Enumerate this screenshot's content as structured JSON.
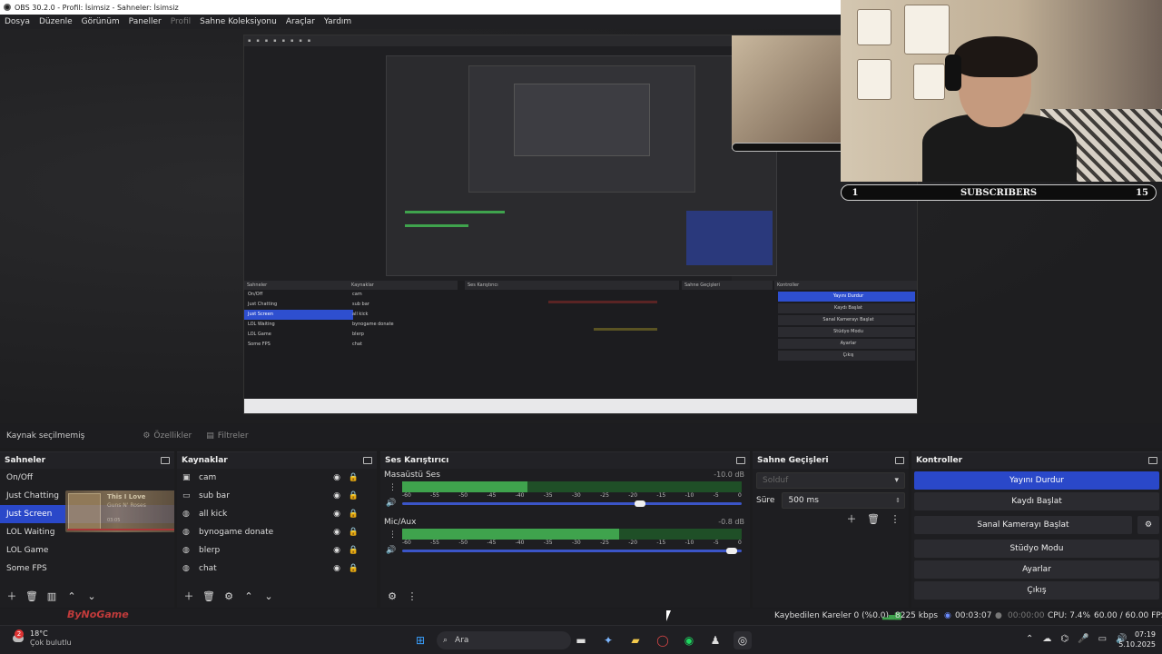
{
  "window": {
    "title": "OBS 30.2.0 - Profil: İsimsiz - Sahneler: İsimsiz"
  },
  "menu": {
    "items": [
      {
        "label": "Dosya",
        "enabled": true
      },
      {
        "label": "Düzenle",
        "enabled": true
      },
      {
        "label": "Görünüm",
        "enabled": true
      },
      {
        "label": "Paneller",
        "enabled": true
      },
      {
        "label": "Profil",
        "enabled": false
      },
      {
        "label": "Sahne Koleksiyonu",
        "enabled": true
      },
      {
        "label": "Araçlar",
        "enabled": true
      },
      {
        "label": "Yardım",
        "enabled": true
      }
    ]
  },
  "overlay": {
    "subscribers": {
      "rank": "1",
      "label": "SUBSCRIBERS",
      "count": "15"
    }
  },
  "source_bar": {
    "status": "Kaynak seçilmemiş",
    "properties": "Özellikler",
    "filters": "Filtreler"
  },
  "scenes": {
    "title": "Sahneler",
    "items": [
      "On/Off",
      "Just Chatting",
      "Just Screen",
      "LOL Waiting",
      "LOL Game",
      "Some FPS"
    ],
    "selected_index": 2,
    "now_playing": {
      "title": "This I Love",
      "artist": "Guns N' Roses",
      "time": "03:05"
    }
  },
  "sources": {
    "title": "Kaynaklar",
    "items": [
      {
        "name": "cam",
        "icon": "camera-icon"
      },
      {
        "name": "sub bar",
        "icon": "browser-icon"
      },
      {
        "name": "all kick",
        "icon": "globe-icon"
      },
      {
        "name": "bynogame donate",
        "icon": "globe-icon"
      },
      {
        "name": "blerp",
        "icon": "globe-icon"
      },
      {
        "name": "chat",
        "icon": "globe-icon"
      }
    ]
  },
  "mixer": {
    "title": "Ses Karıştırıcı",
    "ticks": [
      "-60",
      "-55",
      "-50",
      "-45",
      "-40",
      "-35",
      "-30",
      "-25",
      "-20",
      "-15",
      "-10",
      "-5",
      "0"
    ],
    "channels": [
      {
        "name": "Masaüstü Ses",
        "db": "-10.0 dB",
        "level": 0.37,
        "volume": 0.7
      },
      {
        "name": "Mic/Aux",
        "db": "-0.8 dB",
        "level": 0.64,
        "volume": 0.97
      }
    ]
  },
  "transitions": {
    "title": "Sahne Geçişleri",
    "type": "Solduf",
    "duration_label": "Süre",
    "duration_value": "500 ms"
  },
  "controls": {
    "title": "Kontroller",
    "buttons": [
      "Yayını Durdur",
      "Kaydı Başlat",
      "Sanal Kamerayı Başlat",
      "Stüdyo Modu",
      "Ayarlar",
      "Çıkış"
    ]
  },
  "status": {
    "dropped": "Kaybedilen Kareler 0 (%0.0)",
    "bitrate": "8225 kbps",
    "stream_time": "00:03:07",
    "rec_time": "00:00:00",
    "cpu": "CPU: 7.4%",
    "fps": "60.00 / 60.00 FPS"
  },
  "taskbar": {
    "weather_temp": "18°C",
    "weather_text": "Çok bulutlu",
    "weather_badge": "2",
    "search_placeholder": "Ara",
    "time": "07:19",
    "date": "5.10.2025"
  },
  "watermark": "ByNoGame",
  "colors": {
    "accent": "#2a48c9",
    "meter_green": "#3fa34d",
    "meter_yellow": "#c8b236",
    "meter_red": "#c23b3b"
  }
}
